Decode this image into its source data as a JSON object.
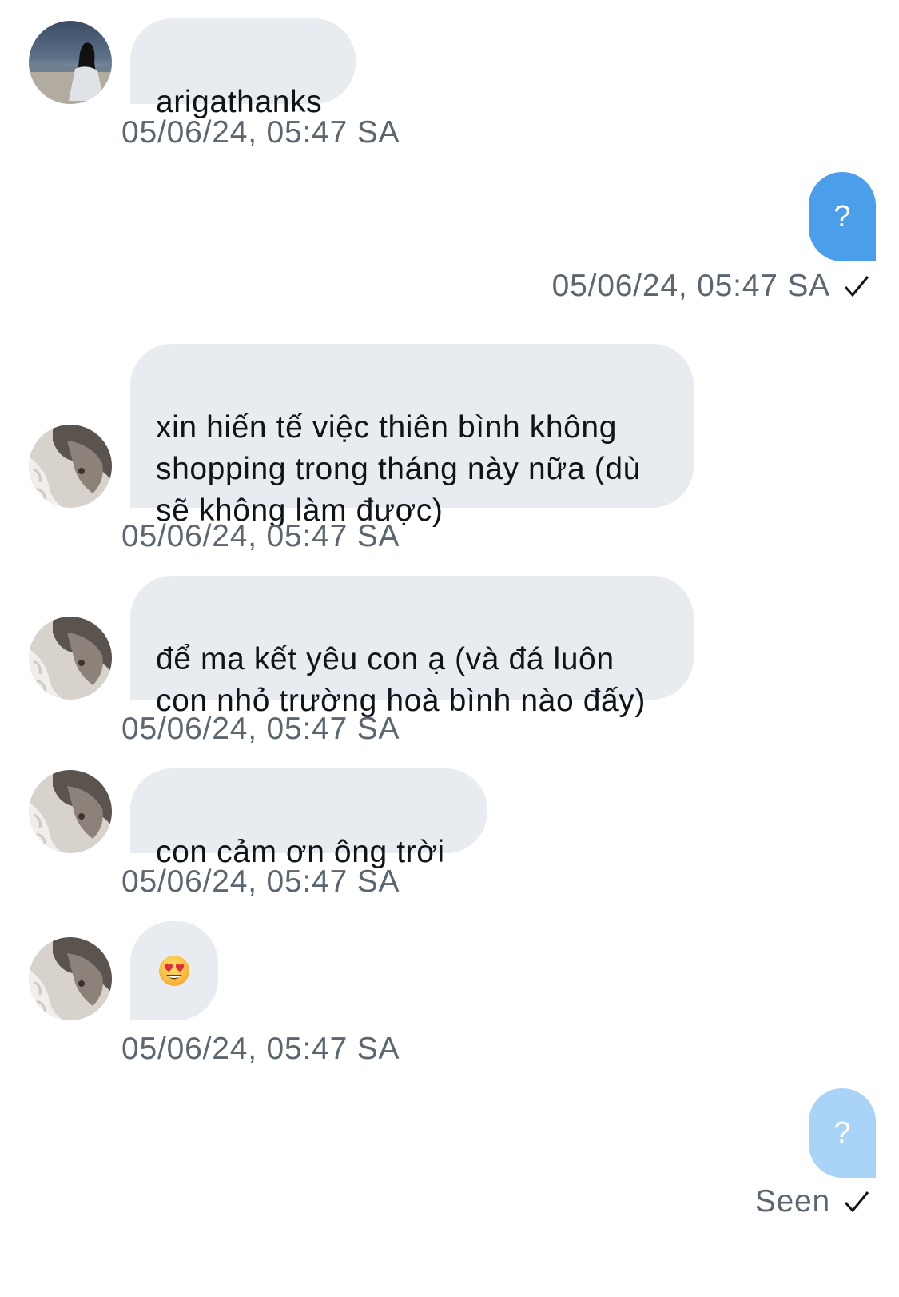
{
  "messages": [
    {
      "from": "them",
      "text": "arigathanks",
      "time": "05/06/24, 05:47 SA",
      "avatar": "beach-person-avatar"
    },
    {
      "from": "me",
      "text": "?",
      "time": "05/06/24, 05:47 SA",
      "status": "sent-check-icon"
    },
    {
      "from": "them",
      "text": "xin hiến tế việc thiên bình không\nshopping trong tháng này nữa (dù\nsẽ không làm được)",
      "time": "05/06/24, 05:47 SA",
      "avatar": "profile-avatar"
    },
    {
      "from": "them",
      "text": "để ma kết yêu con ạ (và đá luôn\ncon nhỏ trường hoà bình nào đấy)",
      "time": "05/06/24, 05:47 SA",
      "avatar": "profile-avatar"
    },
    {
      "from": "them",
      "text": "con cảm ơn ông trời",
      "time": "05/06/24, 05:47 SA",
      "avatar": "profile-avatar"
    },
    {
      "from": "them",
      "emoji": "smiling-face-with-heart-eyes",
      "time": "05/06/24, 05:47 SA",
      "avatar": "profile-avatar"
    },
    {
      "from": "me",
      "text": "?",
      "status_text": "Seen",
      "status": "seen-check-icon"
    }
  ],
  "colors": {
    "incoming_bubble": "#e8ebf0",
    "outgoing_bubble": "#4a9eea",
    "outgoing_pending_bubble": "#a9d3f7",
    "timestamp": "#5b6670",
    "text": "#0f1419"
  }
}
